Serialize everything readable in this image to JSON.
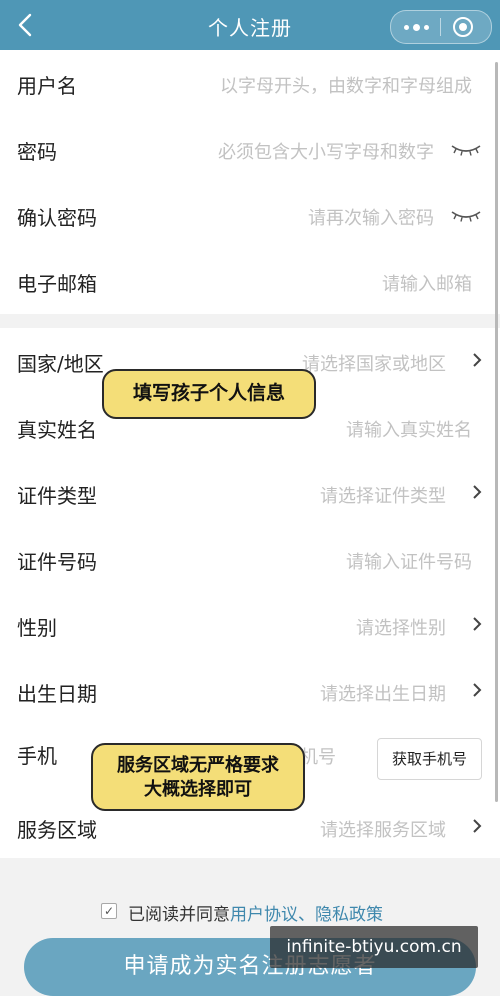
{
  "header": {
    "title": "个人注册",
    "back_icon": "chevron-left-icon",
    "more_icon": "more-dots-icon",
    "close_icon": "miniapp-close-icon",
    "background": "#4f97b6"
  },
  "account_fields": [
    {
      "label": "用户名",
      "placeholder": "以字母开头，由数字和字母组成",
      "trailing": "none"
    },
    {
      "label": "密码",
      "placeholder": "必须包含大小写字母和数字",
      "trailing": "eye-closed-icon"
    },
    {
      "label": "确认密码",
      "placeholder": "请再次输入密码",
      "trailing": "eye-closed-icon"
    },
    {
      "label": "电子邮箱",
      "placeholder": "请输入邮箱",
      "trailing": "none"
    }
  ],
  "info_fields": [
    {
      "label": "国家/地区",
      "placeholder": "请选择国家或地区",
      "trailing": "chevron-right-icon"
    },
    {
      "label": "真实姓名",
      "placeholder": "请输入真实姓名",
      "trailing": "none"
    },
    {
      "label": "证件类型",
      "placeholder": "请选择证件类型",
      "trailing": "chevron-right-icon"
    },
    {
      "label": "证件号码",
      "placeholder": "请输入证件号码",
      "trailing": "none"
    },
    {
      "label": "性别",
      "placeholder": "请选择性别",
      "trailing": "chevron-right-icon"
    },
    {
      "label": "出生日期",
      "placeholder": "请选择出生日期",
      "trailing": "chevron-right-icon"
    },
    {
      "label": "手机",
      "placeholder": "机号",
      "button": "获取手机号"
    },
    {
      "label": "服务区域",
      "placeholder": "请选择服务区域",
      "trailing": "chevron-right-icon"
    }
  ],
  "annotations": {
    "bubble1": "填写孩子个人信息",
    "bubble2_line1": "服务区域无严格要求",
    "bubble2_line2": "大概选择即可"
  },
  "agreement": {
    "checked": true,
    "prefix": "已阅读并同意",
    "link1": "用户协议",
    "separator": "、",
    "link2": "隐私政策"
  },
  "submit_label": "申请成为实名注册志愿者",
  "watermark": "infinite-btiyu.com.cn",
  "colors": {
    "accent": "#4f97b6",
    "link": "#3f88ad",
    "button": "#6aa6c1",
    "bubble": "#f4de78",
    "placeholder": "#c2c2c2"
  }
}
